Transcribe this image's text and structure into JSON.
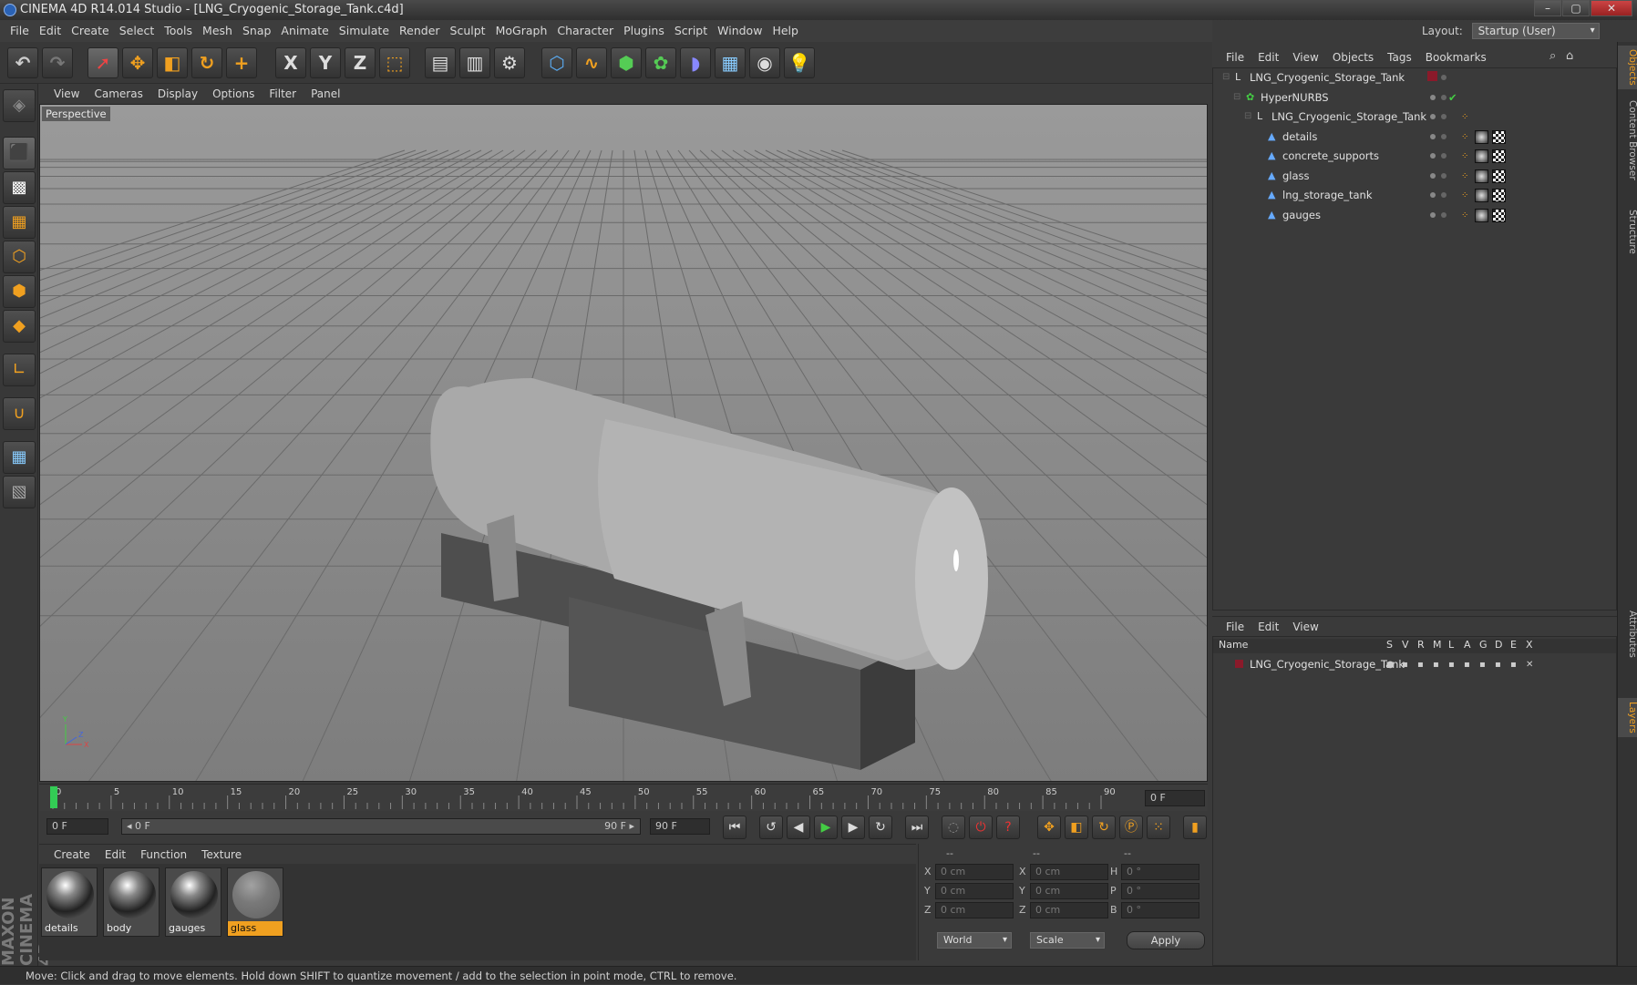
{
  "window": {
    "title": "CINEMA 4D R14.014 Studio - [LNG_Cryogenic_Storage_Tank.c4d]",
    "minimize": "–",
    "maximize": "▢",
    "close": "✕"
  },
  "menu": [
    "File",
    "Edit",
    "Create",
    "Select",
    "Tools",
    "Mesh",
    "Snap",
    "Animate",
    "Simulate",
    "Render",
    "Sculpt",
    "MoGraph",
    "Character",
    "Plugins",
    "Script",
    "Window",
    "Help"
  ],
  "layout": {
    "label": "Layout:",
    "value": "Startup (User)"
  },
  "toolbar": {
    "icons": [
      "undo-icon",
      "redo-icon",
      "live-selection-icon",
      "move-icon",
      "scale-icon",
      "rotate-icon",
      "add-icon",
      "x-axis-icon",
      "y-axis-icon",
      "z-axis-icon",
      "coordinate-system-icon",
      "render-view-icon",
      "render-picture-viewer-icon",
      "render-settings-icon",
      "cube-icon",
      "spline-icon",
      "nurbs-icon",
      "array-icon",
      "deformer-icon",
      "floor-icon",
      "camera-icon",
      "light-icon"
    ],
    "axis_labels": [
      "X",
      "Y",
      "Z"
    ]
  },
  "viewport": {
    "menu": [
      "View",
      "Cameras",
      "Display",
      "Options",
      "Filter",
      "Panel"
    ],
    "label": "Perspective",
    "axes": [
      "Y",
      "X",
      "Z"
    ]
  },
  "timeline": {
    "ticks": [
      "0",
      "5",
      "10",
      "15",
      "20",
      "25",
      "30",
      "35",
      "40",
      "45",
      "50",
      "55",
      "60",
      "65",
      "70",
      "75",
      "80",
      "85",
      "90"
    ],
    "current_frame": "0 F",
    "start_field": "0 F",
    "range_start": "◂ 0 F",
    "range_end": "90 F ▸",
    "end_field": "90 F",
    "current_pct": 0
  },
  "materials": {
    "menu": [
      "Create",
      "Edit",
      "Function",
      "Texture"
    ],
    "items": [
      {
        "name": "details",
        "selected": false
      },
      {
        "name": "body",
        "selected": false
      },
      {
        "name": "gauges",
        "selected": false
      },
      {
        "name": "glass",
        "selected": true
      }
    ]
  },
  "coordinates": {
    "headers": [
      "--",
      "--",
      "--"
    ],
    "rows": [
      {
        "pos_axis": "X",
        "pos": "0 cm",
        "size_axis": "X",
        "size": "0 cm",
        "rot_axis": "H",
        "rot": "0 °"
      },
      {
        "pos_axis": "Y",
        "pos": "0 cm",
        "size_axis": "Y",
        "size": "0 cm",
        "rot_axis": "P",
        "rot": "0 °"
      },
      {
        "pos_axis": "Z",
        "pos": "0 cm",
        "size_axis": "Z",
        "size": "0 cm",
        "rot_axis": "B",
        "rot": "0 °"
      }
    ],
    "mode": "World",
    "scale": "Scale",
    "apply": "Apply"
  },
  "objects": {
    "menu": [
      "File",
      "Edit",
      "View",
      "Objects",
      "Tags",
      "Bookmarks"
    ],
    "tree": [
      {
        "name": "LNG_Cryogenic_Storage_Tank",
        "indent": 0,
        "type": "null"
      },
      {
        "name": "HyperNURBS",
        "indent": 1,
        "type": "nurbs"
      },
      {
        "name": "LNG_Cryogenic_Storage_Tank",
        "indent": 2,
        "type": "null"
      },
      {
        "name": "details",
        "indent": 3,
        "type": "poly"
      },
      {
        "name": "concrete_supports",
        "indent": 3,
        "type": "poly"
      },
      {
        "name": "glass",
        "indent": 3,
        "type": "poly"
      },
      {
        "name": "lng_storage_tank",
        "indent": 3,
        "type": "poly"
      },
      {
        "name": "gauges",
        "indent": 3,
        "type": "poly"
      }
    ]
  },
  "layers": {
    "menu": [
      "File",
      "Edit",
      "View"
    ],
    "header": {
      "name": "Name",
      "cols": [
        "S",
        "V",
        "R",
        "M",
        "L",
        "A",
        "G",
        "D",
        "E",
        "X"
      ]
    },
    "rows": [
      {
        "name": "LNG_Cryogenic_Storage_Tank",
        "color": "#8a1a2a"
      }
    ]
  },
  "sidetabs": [
    "Objects",
    "Content Browser",
    "Structure",
    "Attributes",
    "Layers"
  ],
  "status": "Move: Click and drag to move elements. Hold down SHIFT to quantize movement / add to the selection in point mode, CTRL to remove.",
  "brand": "MAXON CINEMA 4D",
  "colors": {
    "accent": "#f0a020",
    "bg": "#3a3a3a"
  }
}
